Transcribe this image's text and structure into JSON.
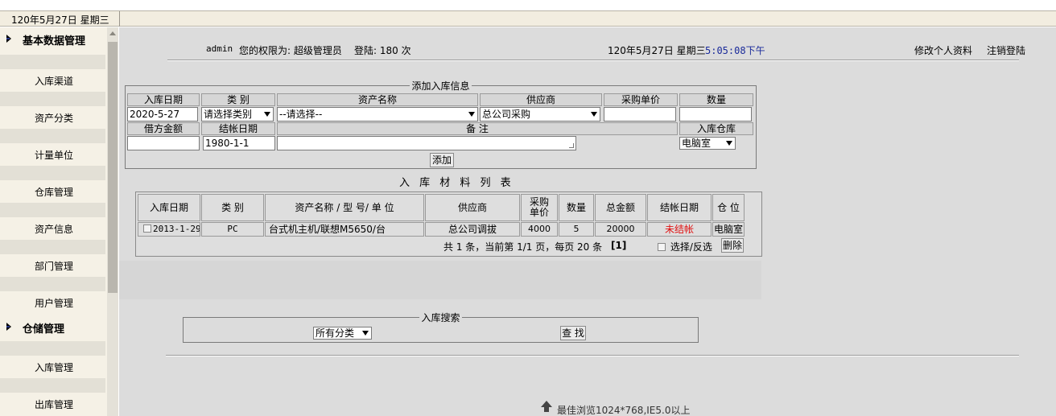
{
  "topbar": {
    "date": "120年5月27日 星期三"
  },
  "sidebar": {
    "groups": [
      {
        "label": "基本数据管理",
        "items": [
          "入库渠道",
          "资产分类",
          "计量单位",
          "仓库管理",
          "资产信息",
          "部门管理",
          "用户管理"
        ]
      },
      {
        "label": "仓储管理",
        "items": [
          "入库管理",
          "出库管理"
        ]
      }
    ]
  },
  "header": {
    "user": "admin",
    "permission_text": "您的权限为: 超级管理员",
    "login_text": "登陆: 180 次",
    "date": "120年5月27日 星期三",
    "clock": "5:05:08下午",
    "edit_profile": "修改个人资料",
    "logout": "注销登陆"
  },
  "add_form": {
    "legend": "添加入库信息",
    "headers": [
      "入库日期",
      "类 别",
      "资产名称",
      "供应商",
      "采购单价",
      "数量"
    ],
    "headers2": [
      "借方金额",
      "结帐日期",
      "备 注",
      "入库仓库"
    ],
    "date_value": "2020-5-27",
    "category_select": "请选择类别",
    "asset_select": "--请选择--",
    "supplier_select": "总公司采购",
    "unit_price": "",
    "quantity": "",
    "debit_amount": "",
    "settle_date": "1980-1-1",
    "remark": "",
    "warehouse_select": "电脑室",
    "add_button": "添加"
  },
  "list": {
    "title": "入 库 材 料 列 表",
    "columns": [
      "入库日期",
      "类 别",
      "资产名称 / 型 号/ 单 位",
      "供应商",
      "采购单价",
      "数量",
      "总金额",
      "结帐日期",
      "仓 位"
    ],
    "rows": [
      {
        "date": "2013-1-29",
        "category": "PC",
        "asset": "台式机主机/联想M5650/台",
        "supplier": "总公司调拔",
        "price": "4000",
        "qty": "5",
        "total": "20000",
        "settle": "未结帐",
        "warehouse": "电脑室"
      }
    ],
    "pager_text": "共 1 条，当前第 1/1 页，每页 20 条",
    "pager_page": "[1]",
    "select_all": "选择/反选",
    "delete_button": "删除"
  },
  "search": {
    "legend": "入库搜索",
    "category_select": "所有分类",
    "search_button": "查 找"
  },
  "footer": {
    "text": "最佳浏览1024*768,IE5.0以上"
  },
  "colors": {
    "clock": "#1a2a9a",
    "unsettled": "#e01010",
    "sidebar_bg": "#f5f1e6",
    "main_bg": "#dcdcdc"
  }
}
